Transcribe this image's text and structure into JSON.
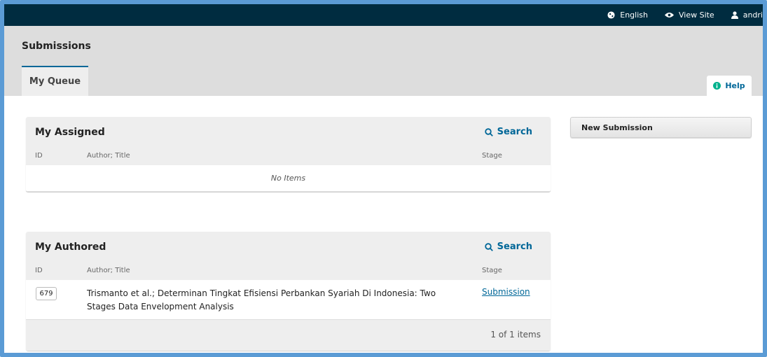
{
  "topbar": {
    "language": "English",
    "view_site": "View Site",
    "user": "andri"
  },
  "header": {
    "title": "Submissions",
    "tabs": [
      {
        "label": "My Queue"
      }
    ],
    "help": "Help"
  },
  "assigned": {
    "title": "My Assigned",
    "search": "Search",
    "columns": {
      "id": "ID",
      "author_title": "Author; Title",
      "stage": "Stage"
    },
    "empty": "No Items"
  },
  "authored": {
    "title": "My Authored",
    "search": "Search",
    "columns": {
      "id": "ID",
      "author_title": "Author; Title",
      "stage": "Stage"
    },
    "items": [
      {
        "id": "679",
        "title": "Trismanto et al.; Determinan Tingkat Efisiensi Perbankan Syariah Di Indonesia: Two Stages Data Envelopment Analysis",
        "stage": "Submission"
      }
    ],
    "pager": "1 of 1 items"
  },
  "sidebar": {
    "new_submission": "New Submission"
  },
  "colors": {
    "brand_dark": "#002c40",
    "accent": "#006798",
    "frame": "#5b9bd5"
  },
  "icons": [
    "globe-icon",
    "eye-icon",
    "user-icon",
    "info-circle-icon",
    "search-icon"
  ]
}
